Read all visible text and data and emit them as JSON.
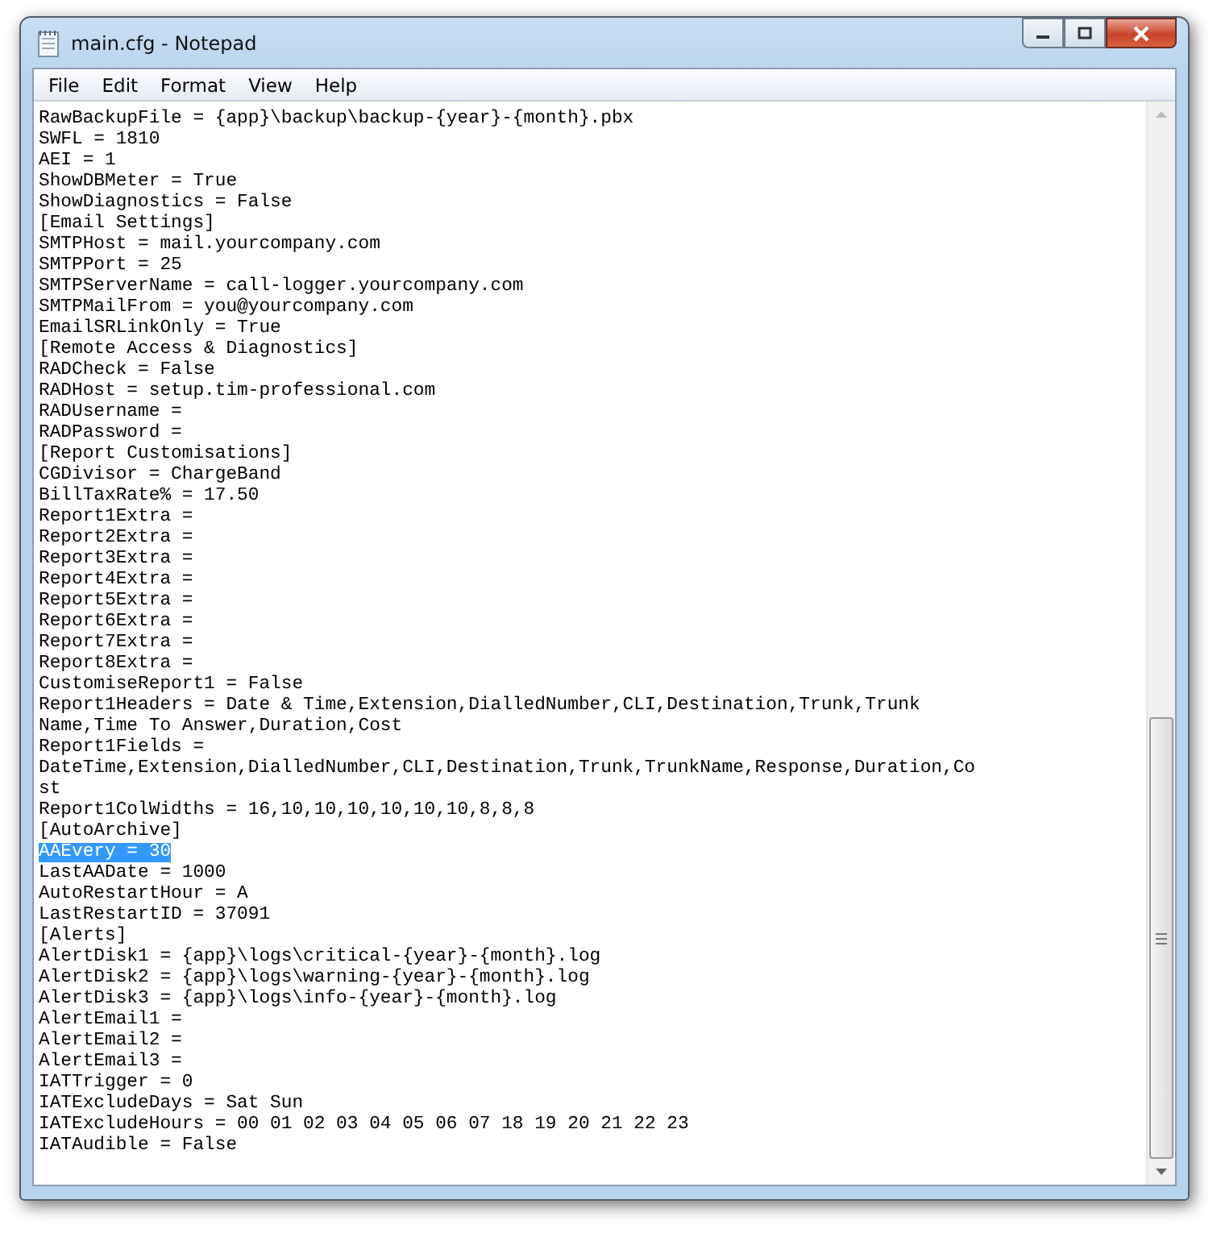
{
  "window": {
    "title": "main.cfg - Notepad"
  },
  "menu": [
    "File",
    "Edit",
    "Format",
    "View",
    "Help"
  ],
  "lines": [
    {
      "text": "RawBackupFile = {app}\\backup\\backup-{year}-{month}.pbx",
      "selected": false
    },
    {
      "text": "SWFL = 1810",
      "selected": false
    },
    {
      "text": "AEI = 1",
      "selected": false
    },
    {
      "text": "ShowDBMeter = True",
      "selected": false
    },
    {
      "text": "ShowDiagnostics = False",
      "selected": false
    },
    {
      "text": "[Email Settings]",
      "selected": false
    },
    {
      "text": "SMTPHost = mail.yourcompany.com",
      "selected": false
    },
    {
      "text": "SMTPPort = 25",
      "selected": false
    },
    {
      "text": "SMTPServerName = call-logger.yourcompany.com",
      "selected": false
    },
    {
      "text": "SMTPMailFrom = you@yourcompany.com",
      "selected": false
    },
    {
      "text": "EmailSRLinkOnly = True",
      "selected": false
    },
    {
      "text": "[Remote Access & Diagnostics]",
      "selected": false
    },
    {
      "text": "RADCheck = False",
      "selected": false
    },
    {
      "text": "RADHost = setup.tim-professional.com",
      "selected": false
    },
    {
      "text": "RADUsername =",
      "selected": false
    },
    {
      "text": "RADPassword =",
      "selected": false
    },
    {
      "text": "[Report Customisations]",
      "selected": false
    },
    {
      "text": "CGDivisor = ChargeBand",
      "selected": false
    },
    {
      "text": "BillTaxRate% = 17.50",
      "selected": false
    },
    {
      "text": "Report1Extra =",
      "selected": false
    },
    {
      "text": "Report2Extra =",
      "selected": false
    },
    {
      "text": "Report3Extra =",
      "selected": false
    },
    {
      "text": "Report4Extra =",
      "selected": false
    },
    {
      "text": "Report5Extra =",
      "selected": false
    },
    {
      "text": "Report6Extra =",
      "selected": false
    },
    {
      "text": "Report7Extra =",
      "selected": false
    },
    {
      "text": "Report8Extra =",
      "selected": false
    },
    {
      "text": "CustomiseReport1 = False",
      "selected": false
    },
    {
      "text": "Report1Headers = Date & Time,Extension,DialledNumber,CLI,Destination,Trunk,Trunk",
      "selected": false
    },
    {
      "text": "Name,Time To Answer,Duration,Cost",
      "selected": false
    },
    {
      "text": "Report1Fields =",
      "selected": false
    },
    {
      "text": "DateTime,Extension,DialledNumber,CLI,Destination,Trunk,TrunkName,Response,Duration,Co",
      "selected": false
    },
    {
      "text": "st",
      "selected": false
    },
    {
      "text": "Report1ColWidths = 16,10,10,10,10,10,10,8,8,8",
      "selected": false
    },
    {
      "text": "[AutoArchive]",
      "selected": false
    },
    {
      "text": "AAEvery = 30",
      "selected": true
    },
    {
      "text": "LastAADate = 1000",
      "selected": false
    },
    {
      "text": "AutoRestartHour = A",
      "selected": false
    },
    {
      "text": "LastRestartID = 37091",
      "selected": false
    },
    {
      "text": "[Alerts]",
      "selected": false
    },
    {
      "text": "AlertDisk1 = {app}\\logs\\critical-{year}-{month}.log",
      "selected": false
    },
    {
      "text": "AlertDisk2 = {app}\\logs\\warning-{year}-{month}.log",
      "selected": false
    },
    {
      "text": "AlertDisk3 = {app}\\logs\\info-{year}-{month}.log",
      "selected": false
    },
    {
      "text": "AlertEmail1 =",
      "selected": false
    },
    {
      "text": "AlertEmail2 =",
      "selected": false
    },
    {
      "text": "AlertEmail3 =",
      "selected": false
    },
    {
      "text": "IATTrigger = 0",
      "selected": false
    },
    {
      "text": "IATExcludeDays = Sat Sun",
      "selected": false
    },
    {
      "text": "IATExcludeHours = 00 01 02 03 04 05 06 07 18 19 20 21 22 23",
      "selected": false
    },
    {
      "text": "IATAudible = False",
      "selected": false
    }
  ]
}
